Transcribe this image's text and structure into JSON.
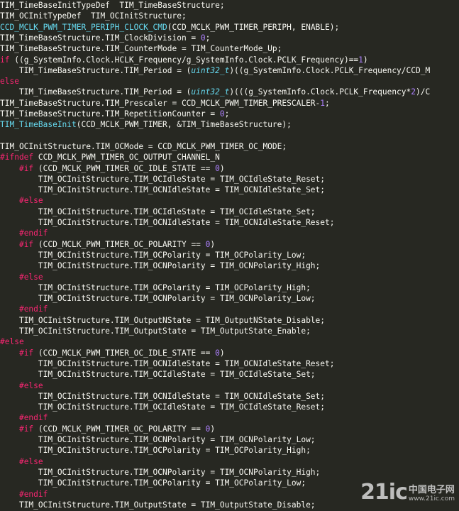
{
  "code_lines": [
    [
      {
        "t": "TIM_TimeBaseInitTypeDef  TIM_TimeBaseStructure;",
        "c": "plain"
      }
    ],
    [
      {
        "t": "TIM_OCInitTypeDef  TIM_OCInitStructure;",
        "c": "plain"
      }
    ],
    [
      {
        "t": "CCD_MCLK_PWM_TIMER_PERIPH_CLOCK_CMD",
        "c": "fn"
      },
      {
        "t": "(CCD_MCLK_PWM_TIMER_PERIPH, ENABLE);",
        "c": "plain"
      }
    ],
    [
      {
        "t": "TIM_TimeBaseStructure.TIM_ClockDivision = ",
        "c": "plain"
      },
      {
        "t": "0",
        "c": "num"
      },
      {
        "t": ";",
        "c": "plain"
      }
    ],
    [
      {
        "t": "TIM_TimeBaseStructure.TIM_CounterMode = TIM_CounterMode_Up;",
        "c": "plain"
      }
    ],
    [
      {
        "t": "if",
        "c": "kw"
      },
      {
        "t": " ((g_SystemInfo.Clock.HCLK_Frequency/g_SystemInfo.Clock.PCLK_Frequency)==",
        "c": "plain"
      },
      {
        "t": "1",
        "c": "num"
      },
      {
        "t": ")",
        "c": "plain"
      }
    ],
    [
      {
        "t": "    TIM_TimeBaseStructure.TIM_Period = (",
        "c": "plain"
      },
      {
        "t": "uint32_t",
        "c": "type"
      },
      {
        "t": ")((g_SystemInfo.Clock.PCLK_Frequency/CCD_M",
        "c": "plain"
      }
    ],
    [
      {
        "t": "else",
        "c": "kw"
      }
    ],
    [
      {
        "t": "    TIM_TimeBaseStructure.TIM_Period = (",
        "c": "plain"
      },
      {
        "t": "uint32_t",
        "c": "type"
      },
      {
        "t": ")(((g_SystemInfo.Clock.PCLK_Frequency*",
        "c": "plain"
      },
      {
        "t": "2",
        "c": "num"
      },
      {
        "t": ")/C",
        "c": "plain"
      }
    ],
    [
      {
        "t": "TIM_TimeBaseStructure.TIM_Prescaler = CCD_MCLK_PWM_TIMER_PRESCALER-",
        "c": "plain"
      },
      {
        "t": "1",
        "c": "num"
      },
      {
        "t": ";",
        "c": "plain"
      }
    ],
    [
      {
        "t": "TIM_TimeBaseStructure.TIM_RepetitionCounter = ",
        "c": "plain"
      },
      {
        "t": "0",
        "c": "num"
      },
      {
        "t": ";",
        "c": "plain"
      }
    ],
    [
      {
        "t": "TIM_TimeBaseInit",
        "c": "fn"
      },
      {
        "t": "(CCD_MCLK_PWM_TIMER, &TIM_TimeBaseStructure);",
        "c": "plain"
      }
    ],
    [],
    [
      {
        "t": "TIM_OCInitStructure.TIM_OCMode = CCD_MCLK_PWM_TIMER_OC_MODE;",
        "c": "plain"
      }
    ],
    [
      {
        "t": "#ifndef",
        "c": "pre"
      },
      {
        "t": " CCD_MCLK_PWM_TIMER_OC_OUTPUT_CHANNEL_N",
        "c": "plain"
      }
    ],
    [
      {
        "t": "    ",
        "c": "plain"
      },
      {
        "t": "#if",
        "c": "pre"
      },
      {
        "t": " (CCD_MCLK_PWM_TIMER_OC_IDLE_STATE == ",
        "c": "plain"
      },
      {
        "t": "0",
        "c": "num"
      },
      {
        "t": ")",
        "c": "plain"
      }
    ],
    [
      {
        "t": "        TIM_OCInitStructure.TIM_OCIdleState = TIM_OCIdleState_Reset;",
        "c": "plain"
      }
    ],
    [
      {
        "t": "        TIM_OCInitStructure.TIM_OCNIdleState = TIM_OCNIdleState_Set;",
        "c": "plain"
      }
    ],
    [
      {
        "t": "    ",
        "c": "plain"
      },
      {
        "t": "#else",
        "c": "pre"
      }
    ],
    [
      {
        "t": "        TIM_OCInitStructure.TIM_OCIdleState = TIM_OCIdleState_Set;",
        "c": "plain"
      }
    ],
    [
      {
        "t": "        TIM_OCInitStructure.TIM_OCNIdleState = TIM_OCNIdleState_Reset;",
        "c": "plain"
      }
    ],
    [
      {
        "t": "    ",
        "c": "plain"
      },
      {
        "t": "#endif",
        "c": "pre"
      }
    ],
    [
      {
        "t": "    ",
        "c": "plain"
      },
      {
        "t": "#if",
        "c": "pre"
      },
      {
        "t": " (CCD_MCLK_PWM_TIMER_OC_POLARITY == ",
        "c": "plain"
      },
      {
        "t": "0",
        "c": "num"
      },
      {
        "t": ")",
        "c": "plain"
      }
    ],
    [
      {
        "t": "        TIM_OCInitStructure.TIM_OCPolarity = TIM_OCPolarity_Low;",
        "c": "plain"
      }
    ],
    [
      {
        "t": "        TIM_OCInitStructure.TIM_OCNPolarity = TIM_OCNPolarity_High;",
        "c": "plain"
      }
    ],
    [
      {
        "t": "    ",
        "c": "plain"
      },
      {
        "t": "#else",
        "c": "pre"
      }
    ],
    [
      {
        "t": "        TIM_OCInitStructure.TIM_OCPolarity = TIM_OCPolarity_High;",
        "c": "plain"
      }
    ],
    [
      {
        "t": "        TIM_OCInitStructure.TIM_OCNPolarity = TIM_OCNPolarity_Low;",
        "c": "plain"
      }
    ],
    [
      {
        "t": "    ",
        "c": "plain"
      },
      {
        "t": "#endif",
        "c": "pre"
      }
    ],
    [
      {
        "t": "    TIM_OCInitStructure.TIM_OutputNState = TIM_OutputNState_Disable;",
        "c": "plain"
      }
    ],
    [
      {
        "t": "    TIM_OCInitStructure.TIM_OutputState = TIM_OutputState_Enable;",
        "c": "plain"
      }
    ],
    [
      {
        "t": "#else",
        "c": "pre"
      }
    ],
    [
      {
        "t": "    ",
        "c": "plain"
      },
      {
        "t": "#if",
        "c": "pre"
      },
      {
        "t": " (CCD_MCLK_PWM_TIMER_OC_IDLE_STATE == ",
        "c": "plain"
      },
      {
        "t": "0",
        "c": "num"
      },
      {
        "t": ")",
        "c": "plain"
      }
    ],
    [
      {
        "t": "        TIM_OCInitStructure.TIM_OCNIdleState = TIM_OCNIdleState_Reset;",
        "c": "plain"
      }
    ],
    [
      {
        "t": "        TIM_OCInitStructure.TIM_OCIdleState = TIM_OCIdleState_Set;",
        "c": "plain"
      }
    ],
    [
      {
        "t": "    ",
        "c": "plain"
      },
      {
        "t": "#else",
        "c": "pre"
      }
    ],
    [
      {
        "t": "        TIM_OCInitStructure.TIM_OCNIdleState = TIM_OCNIdleState_Set;",
        "c": "plain"
      }
    ],
    [
      {
        "t": "        TIM_OCInitStructure.TIM_OCIdleState = TIM_OCIdleState_Reset;",
        "c": "plain"
      }
    ],
    [
      {
        "t": "    ",
        "c": "plain"
      },
      {
        "t": "#endif",
        "c": "pre"
      }
    ],
    [
      {
        "t": "    ",
        "c": "plain"
      },
      {
        "t": "#if",
        "c": "pre"
      },
      {
        "t": " (CCD_MCLK_PWM_TIMER_OC_POLARITY == ",
        "c": "plain"
      },
      {
        "t": "0",
        "c": "num"
      },
      {
        "t": ")",
        "c": "plain"
      }
    ],
    [
      {
        "t": "        TIM_OCInitStructure.TIM_OCNPolarity = TIM_OCNPolarity_Low;",
        "c": "plain"
      }
    ],
    [
      {
        "t": "        TIM_OCInitStructure.TIM_OCPolarity = TIM_OCPolarity_High;",
        "c": "plain"
      }
    ],
    [
      {
        "t": "    ",
        "c": "plain"
      },
      {
        "t": "#else",
        "c": "pre"
      }
    ],
    [
      {
        "t": "        TIM_OCInitStructure.TIM_OCNPolarity = TIM_OCNPolarity_High;",
        "c": "plain"
      }
    ],
    [
      {
        "t": "        TIM_OCInitStructure.TIM_OCPolarity = TIM_OCPolarity_Low;",
        "c": "plain"
      }
    ],
    [
      {
        "t": "    ",
        "c": "plain"
      },
      {
        "t": "#endif",
        "c": "pre"
      }
    ],
    [
      {
        "t": "    TIM_OCInitStructure.TIM_OutputState = TIM_OutputState_Disable;",
        "c": "plain"
      }
    ]
  ],
  "watermark": {
    "logo": "21ic",
    "cn": "中国电子网",
    "url": "www.21ic.com"
  },
  "colors": {
    "background": "#272822",
    "plain": "#f8f8f2",
    "keyword": "#f92672",
    "number": "#ae81ff",
    "function": "#66d9ef"
  }
}
